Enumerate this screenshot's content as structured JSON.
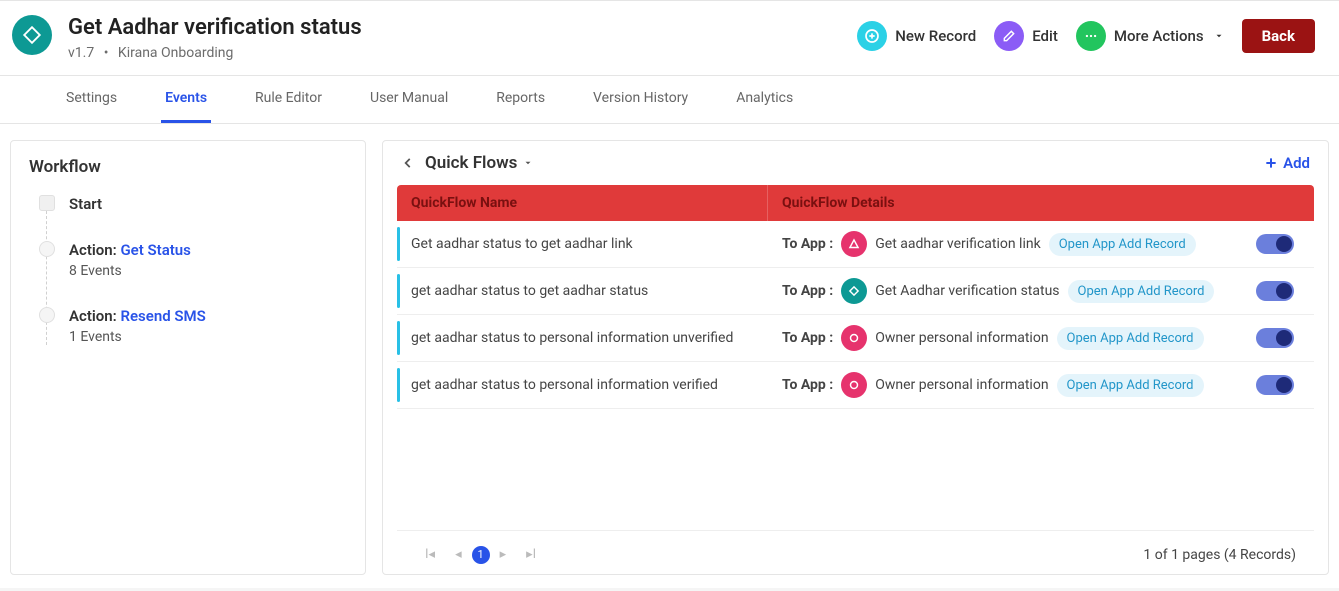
{
  "header": {
    "title": "Get Aadhar verification status",
    "version": "v1.7",
    "context": "Kirana Onboarding",
    "actions": {
      "new_record": "New Record",
      "edit": "Edit",
      "more": "More Actions",
      "back": "Back"
    }
  },
  "tabs": [
    "Settings",
    "Events",
    "Rule Editor",
    "User Manual",
    "Reports",
    "Version History",
    "Analytics"
  ],
  "active_tab": "Events",
  "workflow": {
    "title": "Workflow",
    "items": [
      {
        "label_prefix": "",
        "label": "Start",
        "sub": ""
      },
      {
        "label_prefix": "Action: ",
        "label": "Get Status",
        "sub": "8 Events"
      },
      {
        "label_prefix": "Action: ",
        "label": "Resend SMS",
        "sub": "1 Events"
      }
    ]
  },
  "quickflows": {
    "title": "Quick Flows",
    "add_label": "Add",
    "columns": {
      "name": "QuickFlow Name",
      "details": "QuickFlow Details"
    },
    "to_app_label": "To App :",
    "pill_label": "Open App Add Record",
    "rows": [
      {
        "name": "Get aadhar status to get aadhar link",
        "app": "Get aadhar verification link",
        "icon": "triangle",
        "color": "pink"
      },
      {
        "name": "get aadhar status to get aadhar status",
        "app": "Get Aadhar verification status",
        "icon": "diamond",
        "color": "teal"
      },
      {
        "name": "get aadhar status to personal information unverified",
        "app": "Owner personal information",
        "icon": "circle",
        "color": "pink"
      },
      {
        "name": "get aadhar status to personal information verified",
        "app": "Owner personal information",
        "icon": "circle",
        "color": "pink"
      }
    ]
  },
  "pagination": {
    "current": "1",
    "info": "1 of 1 pages (4 Records)"
  }
}
